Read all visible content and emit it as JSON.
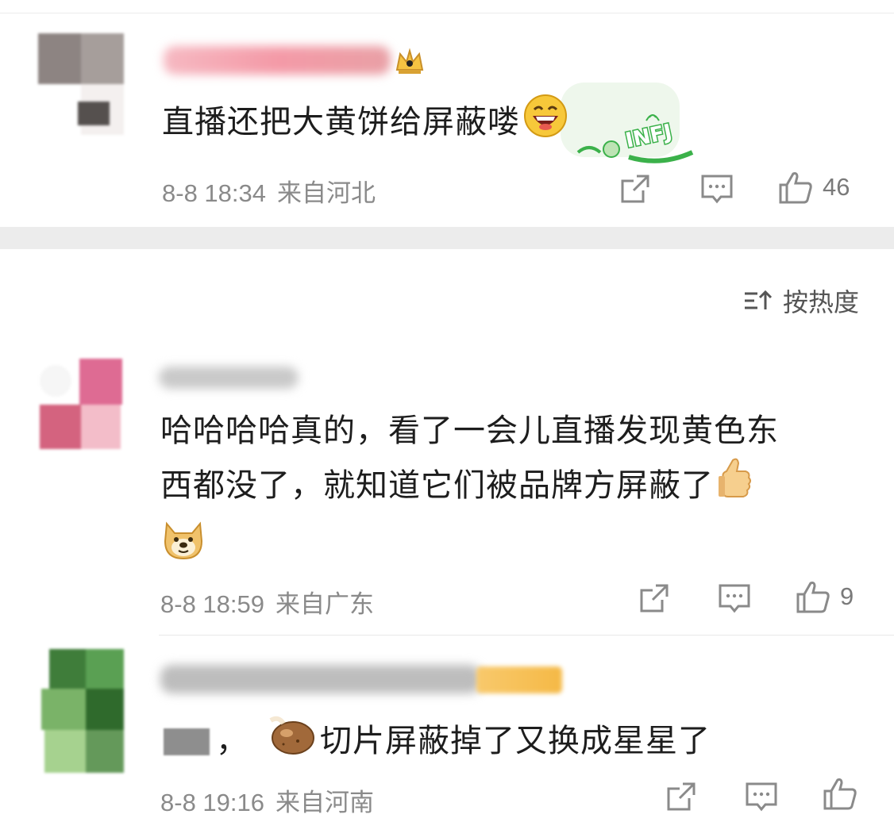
{
  "comments": [
    {
      "text": "直播还把大黄饼给屏蔽喽",
      "date": "8-8 18:34",
      "location": "来自河北",
      "likes": "46",
      "emoji": "grinning-emoji",
      "badge": "INFJ"
    },
    {
      "text_line1": "哈哈哈哈真的，看了一会儿直播发现黄色东",
      "text_line2": "西都没了，就知道它们被品牌方屏蔽了",
      "date": "8-8 18:59",
      "location": "来自广东",
      "likes": "9",
      "emojis": [
        "thumbs-up-emoji",
        "doge-emoji"
      ]
    },
    {
      "text_visible_prefix": "，",
      "text": "切片屏蔽掉了又换成星星了",
      "date": "8-8 19:16",
      "location": "来自河南",
      "likes": "",
      "emoji": "potato-emoji"
    }
  ],
  "sort": {
    "label": "按热度",
    "icon": "sort-icon"
  },
  "icons": {
    "share": "share-icon",
    "reply": "comment-icon",
    "like": "thumbs-up-icon"
  },
  "colors": {
    "text": "#1d1d1d",
    "meta": "#8a8a8a",
    "divider": "#ececec",
    "badge_green": "#3bb14a",
    "vip_gold": "#f5c342"
  }
}
